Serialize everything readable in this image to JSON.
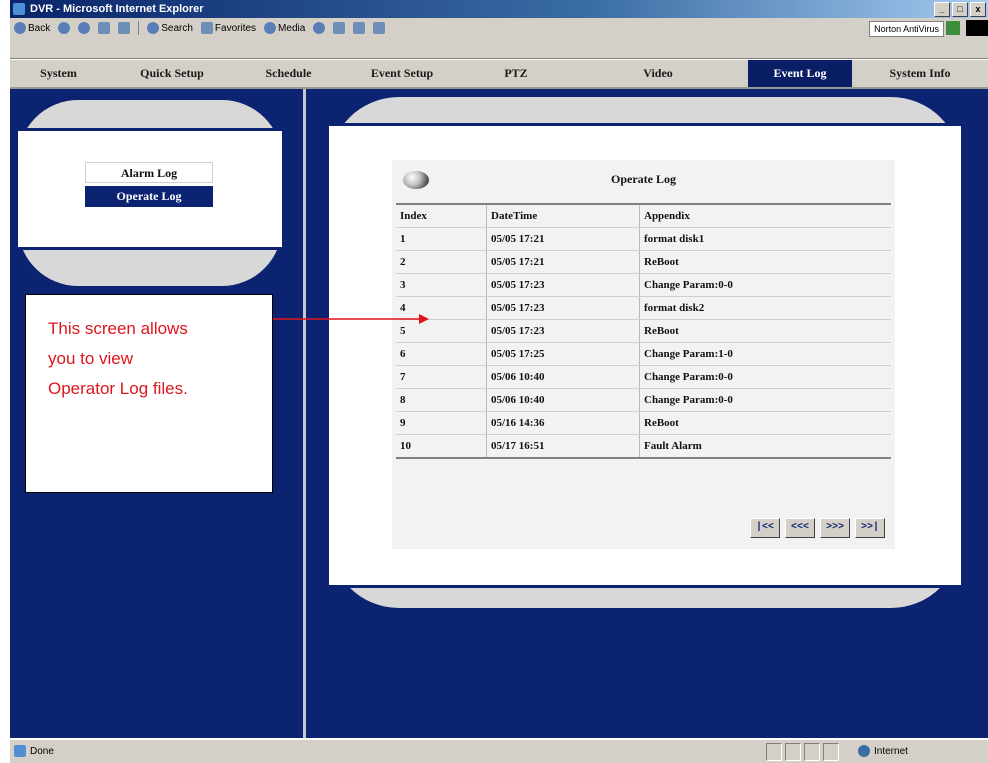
{
  "window": {
    "title": "DVR - Microsoft Internet Explorer",
    "controls": [
      "_",
      "□",
      "x"
    ]
  },
  "toolbar": {
    "back": "Back",
    "search": "Search",
    "favorites": "Favorites",
    "media": "Media",
    "antivirus": "Norton AntiVirus"
  },
  "nav": {
    "items": [
      "System",
      "Quick Setup",
      "Schedule",
      "Event Setup",
      "PTZ",
      "Video",
      "Event Log",
      "System Info"
    ],
    "active": "Event Log"
  },
  "sidebar": {
    "items": [
      "Alarm Log",
      "Operate Log"
    ],
    "selected": "Operate Log"
  },
  "log": {
    "title": "Operate Log",
    "columns": [
      "Index",
      "DateTime",
      "Appendix"
    ],
    "rows": [
      [
        "1",
        "05/05 17:21",
        "format disk1"
      ],
      [
        "2",
        "05/05 17:21",
        "ReBoot"
      ],
      [
        "3",
        "05/05 17:23",
        "Change Param:0-0"
      ],
      [
        "4",
        "05/05 17:23",
        "format disk2"
      ],
      [
        "5",
        "05/05 17:23",
        "ReBoot"
      ],
      [
        "6",
        "05/05 17:25",
        "Change Param:1-0"
      ],
      [
        "7",
        "05/06 10:40",
        "Change Param:0-0"
      ],
      [
        "8",
        "05/06 10:40",
        "Change Param:0-0"
      ],
      [
        "9",
        "05/16 14:36",
        "ReBoot"
      ],
      [
        "10",
        "05/17 16:51",
        "Fault  Alarm"
      ]
    ],
    "pager": [
      "|<<",
      "<<<",
      ">>>",
      ">>|"
    ]
  },
  "callout": {
    "lines": [
      "This screen allows",
      "you to view",
      "Operator Log files."
    ],
    "color": "#e0141e"
  },
  "status": {
    "left": "Done",
    "zone": "Internet"
  },
  "colors": {
    "panel": "#0b2371",
    "frame": "#d8d8d8"
  }
}
